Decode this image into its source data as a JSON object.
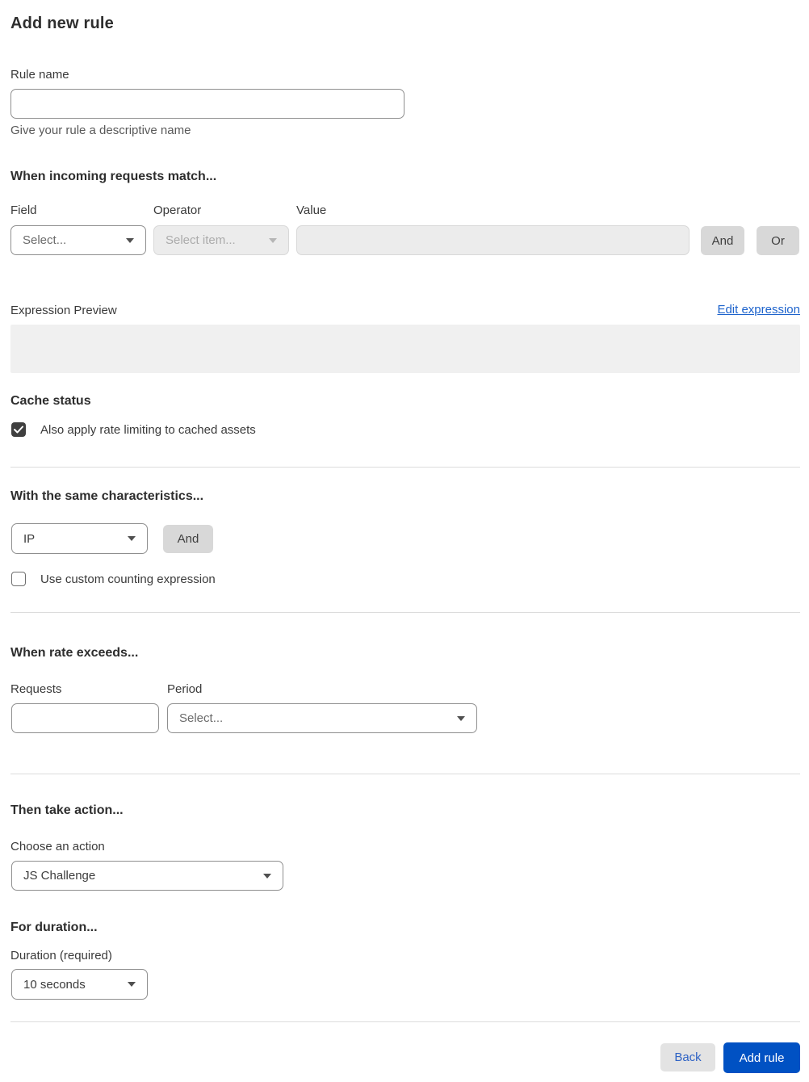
{
  "page": {
    "title": "Add new rule"
  },
  "rule_name": {
    "label": "Rule name",
    "value": "",
    "help": "Give your rule a descriptive name"
  },
  "match": {
    "heading": "When incoming requests match...",
    "field_label": "Field",
    "field_value": "Select...",
    "operator_label": "Operator",
    "operator_value": "Select item...",
    "value_label": "Value",
    "value_text": "",
    "and_label": "And",
    "or_label": "Or"
  },
  "expression": {
    "label": "Expression Preview",
    "edit_link": "Edit expression",
    "preview": ""
  },
  "cache": {
    "heading": "Cache status",
    "checkbox_label": "Also apply rate limiting to cached assets",
    "checked": true
  },
  "characteristics": {
    "heading": "With the same characteristics...",
    "selected": "IP",
    "and_label": "And",
    "custom_checkbox_label": "Use custom counting expression",
    "custom_checked": false
  },
  "rate": {
    "heading": "When rate exceeds...",
    "requests_label": "Requests",
    "requests_value": "",
    "period_label": "Period",
    "period_value": "Select..."
  },
  "action": {
    "heading": "Then take action...",
    "label": "Choose an action",
    "selected": "JS Challenge"
  },
  "duration": {
    "heading": "For duration...",
    "label": "Duration (required)",
    "selected": "10 seconds"
  },
  "footer": {
    "back_label": "Back",
    "submit_label": "Add rule"
  },
  "colors": {
    "primary_button": "#0051c3",
    "link": "#1d63cc",
    "checkbox_checked": "#3f3f3f",
    "disabled_fill": "#ececec"
  }
}
